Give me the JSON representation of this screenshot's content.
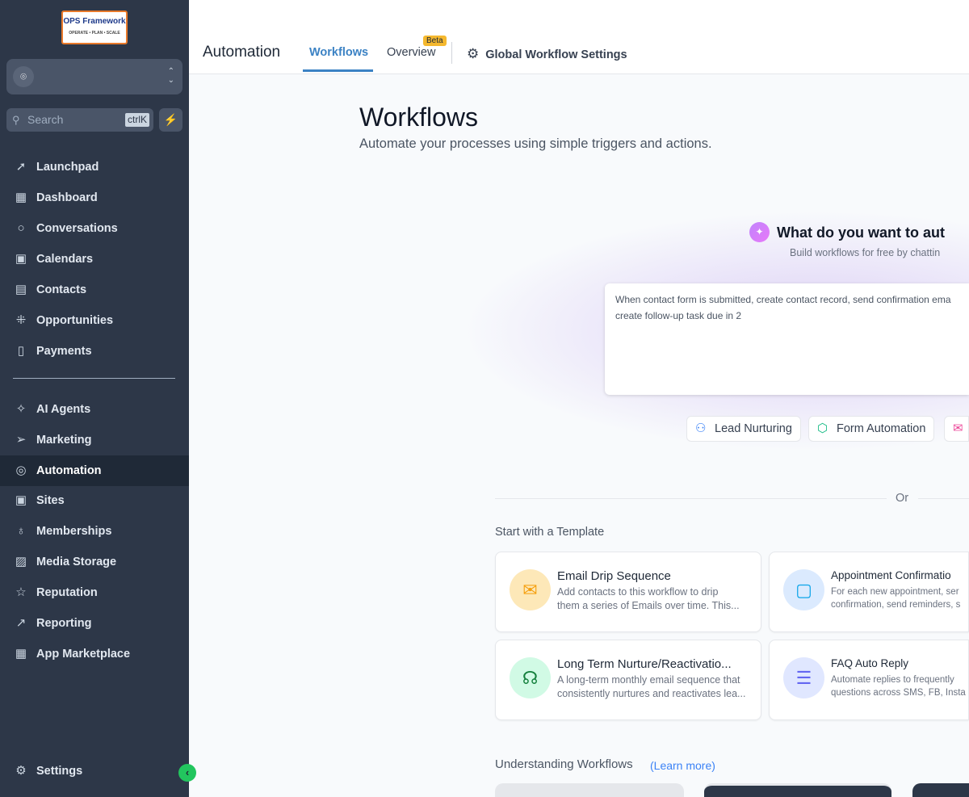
{
  "logo": {
    "text": "OPS Framework",
    "tagline": "OPERATE • PLAN • SCALE"
  },
  "sidebar": {
    "search_placeholder": "Search",
    "shortcut": "ctrlK",
    "items": [
      {
        "label": "Launchpad",
        "icon": "rocket-icon"
      },
      {
        "label": "Dashboard",
        "icon": "grid-icon"
      },
      {
        "label": "Conversations",
        "icon": "chat-icon"
      },
      {
        "label": "Calendars",
        "icon": "calendar-icon"
      },
      {
        "label": "Contacts",
        "icon": "contacts-icon"
      },
      {
        "label": "Opportunities",
        "icon": "pipeline-icon"
      },
      {
        "label": "Payments",
        "icon": "payment-icon"
      },
      {
        "label": "AI Agents",
        "icon": "sparkle-icon"
      },
      {
        "label": "Marketing",
        "icon": "send-icon"
      },
      {
        "label": "Automation",
        "icon": "automation-icon"
      },
      {
        "label": "Sites",
        "icon": "sites-icon"
      },
      {
        "label": "Memberships",
        "icon": "award-icon"
      },
      {
        "label": "Media Storage",
        "icon": "image-icon"
      },
      {
        "label": "Reputation",
        "icon": "star-icon"
      },
      {
        "label": "Reporting",
        "icon": "trend-icon"
      },
      {
        "label": "App Marketplace",
        "icon": "apps-icon"
      }
    ],
    "settings": "Settings"
  },
  "header": {
    "title": "Automation",
    "tabs": [
      {
        "label": "Workflows"
      },
      {
        "label": "Overview"
      }
    ],
    "beta": "Beta",
    "global_settings": "Global Workflow Settings"
  },
  "page": {
    "title": "Workflows",
    "subtitle": "Automate your processes using simple triggers and actions."
  },
  "ai": {
    "title": "What do you want to aut",
    "subtitle": "Build workflows for free by chattin",
    "prompt": "When contact form is submitted, create contact record, send confirmation ema\ncreate follow-up task due in 2",
    "chips": [
      {
        "label": "Lead Nurturing"
      },
      {
        "label": "Form Automation"
      },
      {
        "label": ""
      }
    ]
  },
  "or": "Or",
  "templates": {
    "heading": "Start with a Template",
    "items": [
      {
        "title": "Email Drip Sequence",
        "desc1": "Add contacts to this workflow to drip",
        "desc2": "them a series of Emails over time. This..."
      },
      {
        "title": "Appointment Confirmatio",
        "desc1": "For each new appointment, ser",
        "desc2": "confirmation, send reminders, s"
      },
      {
        "title": "Long Term Nurture/Reactivatio...",
        "desc1": "A long-term monthly email sequence that",
        "desc2": "consistently nurtures and reactivates lea..."
      },
      {
        "title": "FAQ Auto Reply",
        "desc1": "Automate replies to frequently",
        "desc2": "questions across SMS, FB, Insta"
      }
    ]
  },
  "understanding": {
    "heading": "Understanding Workflows",
    "link": "(Learn more)"
  }
}
